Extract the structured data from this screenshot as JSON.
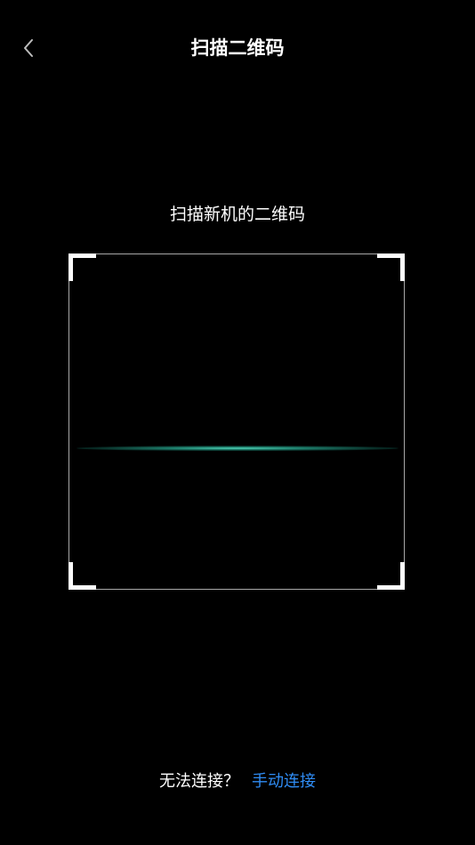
{
  "header": {
    "title": "扫描二维码",
    "back_icon": "chevron-left-icon"
  },
  "scanner": {
    "hint": "扫描新机的二维码",
    "scan_line_color": "#3fd6b8",
    "frame_border_color": "#a8a8a8",
    "corner_color": "#ffffff"
  },
  "footer": {
    "question": "无法连接？",
    "manual_link": "手动连接",
    "link_color": "#2f8cf4"
  }
}
